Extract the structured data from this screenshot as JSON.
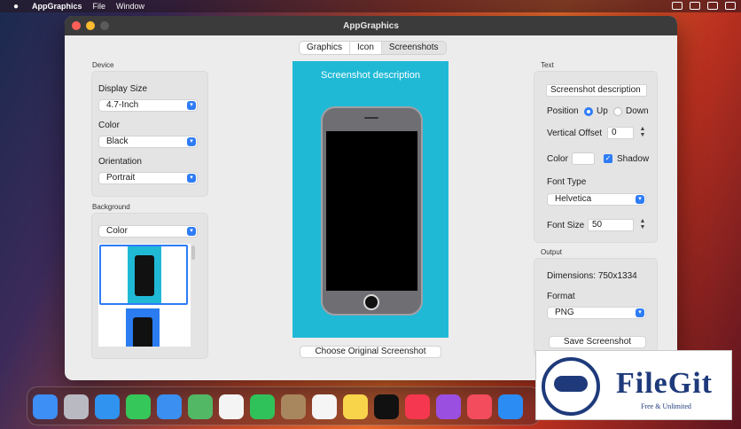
{
  "menubar": {
    "app": "AppGraphics",
    "file": "File",
    "window": "Window"
  },
  "window": {
    "title": "AppGraphics"
  },
  "tabs": [
    "Graphics",
    "Icon",
    "Screenshots"
  ],
  "device": {
    "section": "Device",
    "display_size_label": "Display Size",
    "display_size_value": "4.7-Inch",
    "color_label": "Color",
    "color_value": "Black",
    "orientation_label": "Orientation",
    "orientation_value": "Portrait"
  },
  "background": {
    "section": "Background",
    "type_value": "Color"
  },
  "preview": {
    "screenshot_text": "Screenshot description",
    "choose_button": "Choose Original Screenshot"
  },
  "text_panel": {
    "section": "Text",
    "text_value": "Screenshot description",
    "position_label": "Position",
    "up_label": "Up",
    "down_label": "Down",
    "vertical_offset_label": "Vertical Offset",
    "vertical_offset_value": "0",
    "color_label": "Color",
    "shadow_label": "Shadow",
    "font_type_label": "Font Type",
    "font_type_value": "Helvetica",
    "font_size_label": "Font Size",
    "font_size_value": "50"
  },
  "output": {
    "section": "Output",
    "dimensions_label": "Dimensions:",
    "dimensions_value": "750x1334",
    "format_label": "Format",
    "format_value": "PNG",
    "save_button": "Save Screenshot"
  },
  "watermark": {
    "name": "FileGit",
    "tagline": "Free & Unlimited"
  },
  "colors": {
    "accent": "#2e7cf6",
    "canvas": "#1fb9d6"
  }
}
